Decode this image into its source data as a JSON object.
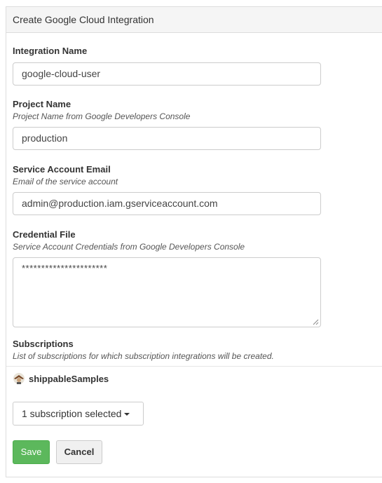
{
  "panel": {
    "title": "Create Google Cloud Integration"
  },
  "fields": {
    "integration_name": {
      "label": "Integration Name",
      "value": "google-cloud-user"
    },
    "project_name": {
      "label": "Project Name",
      "help": "Project Name from Google Developers Console",
      "value": "production"
    },
    "service_account_email": {
      "label": "Service Account Email",
      "help": "Email of the service account",
      "value": "admin@production.iam.gserviceaccount.com"
    },
    "credential_file": {
      "label": "Credential File",
      "help": "Service Account Credentials from Google Developers Console",
      "value": "**********************"
    },
    "subscriptions": {
      "label": "Subscriptions",
      "help": "List of subscriptions for which subscription integrations will be created."
    }
  },
  "account": {
    "name": "shippableSamples",
    "avatar_icon": "account-avatar-icon"
  },
  "subscription_dropdown": {
    "label": "1 subscription selected"
  },
  "actions": {
    "save_label": "Save",
    "cancel_label": "Cancel"
  },
  "colors": {
    "save": "#5cb85c",
    "heading_bg": "#f5f5f5",
    "border": "#cccccc"
  }
}
